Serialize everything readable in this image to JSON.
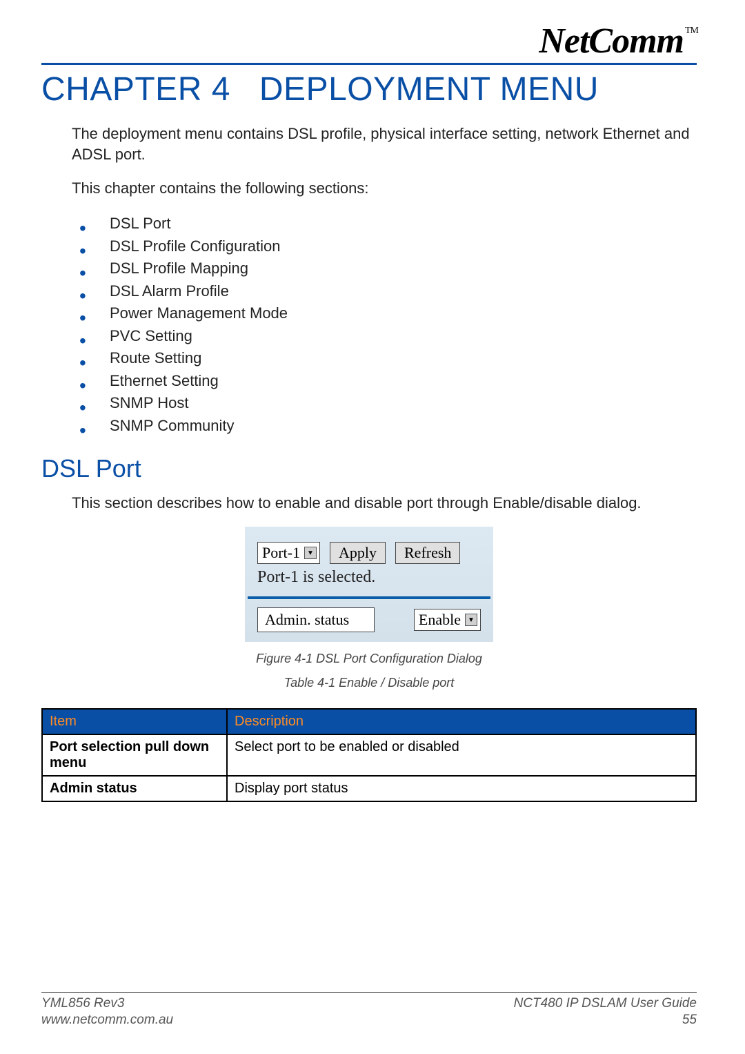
{
  "brand": {
    "name": "NetComm",
    "trademark": "TM"
  },
  "chapter": {
    "number": "CHAPTER 4",
    "title": "DEPLOYMENT MENU"
  },
  "intro": {
    "p1": "The deployment menu contains DSL profile, physical interface setting, network Ethernet and ADSL port.",
    "p2": "This chapter contains the following sections:"
  },
  "sections": [
    "DSL Port",
    "DSL Profile Configuration",
    "DSL Profile Mapping",
    "DSL Alarm Profile",
    "Power Management Mode",
    "PVC Setting",
    "Route Setting",
    "Ethernet Setting",
    "SNMP Host",
    "SNMP Community"
  ],
  "dslport": {
    "heading": "DSL Port",
    "desc": "This section describes how to enable and disable port through Enable/disable dialog."
  },
  "dialog": {
    "port_select": "Port-1",
    "apply": "Apply",
    "refresh": "Refresh",
    "status_text": "Port-1 is selected.",
    "admin_label": "Admin. status",
    "enable_value": "Enable"
  },
  "captions": {
    "figure": "Figure 4-1 DSL Port Configuration Dialog",
    "table": "Table 4-1  Enable / Disable port"
  },
  "table": {
    "headers": {
      "item": "Item",
      "desc": "Description"
    },
    "rows": [
      {
        "item": "Port selection pull down menu",
        "desc": "Select port to be enabled or disabled"
      },
      {
        "item": "Admin status",
        "desc": "Display port status"
      }
    ]
  },
  "footer": {
    "rev": "YML856 Rev3",
    "url": "www.netcomm.com.au",
    "guide": "NCT480 IP DSLAM User Guide",
    "page": "55"
  }
}
